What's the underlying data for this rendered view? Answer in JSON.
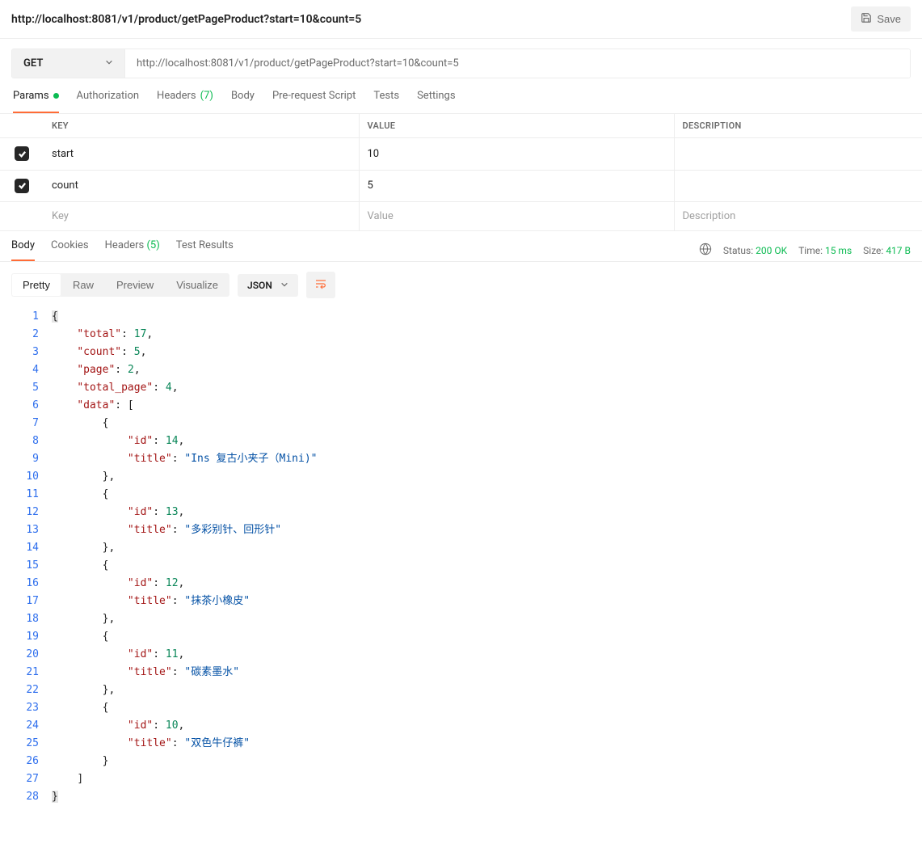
{
  "header": {
    "title": "http://localhost:8081/v1/product/getPageProduct?start=10&count=5",
    "save_label": "Save"
  },
  "request": {
    "method": "GET",
    "url": "http://localhost:8081/v1/product/getPageProduct?start=10&count=5"
  },
  "req_tabs": {
    "params": "Params",
    "authorization": "Authorization",
    "headers": "Headers",
    "headers_count": "(7)",
    "body": "Body",
    "prerequest": "Pre-request Script",
    "tests": "Tests",
    "settings": "Settings"
  },
  "params_table": {
    "col_key": "KEY",
    "col_value": "VALUE",
    "col_desc": "DESCRIPTION",
    "rows": [
      {
        "key": "start",
        "value": "10",
        "desc": ""
      },
      {
        "key": "count",
        "value": "5",
        "desc": ""
      }
    ],
    "ph_key": "Key",
    "ph_value": "Value",
    "ph_desc": "Description"
  },
  "resp_tabs": {
    "body": "Body",
    "cookies": "Cookies",
    "headers": "Headers",
    "headers_count": "(5)",
    "test_results": "Test Results"
  },
  "resp_meta": {
    "status_label": "Status:",
    "status_value": "200 OK",
    "time_label": "Time:",
    "time_value": "15 ms",
    "size_label": "Size:",
    "size_value": "417 B"
  },
  "view": {
    "pretty": "Pretty",
    "raw": "Raw",
    "preview": "Preview",
    "visualize": "Visualize",
    "format": "JSON"
  },
  "response_json": {
    "total": 17,
    "count": 5,
    "page": 2,
    "total_page": 4,
    "data": [
      {
        "id": 14,
        "title": "Ins 复古小夹子（Mini)"
      },
      {
        "id": 13,
        "title": "多彩别针、回形针"
      },
      {
        "id": 12,
        "title": "抹茶小橡皮"
      },
      {
        "id": 11,
        "title": "碳素墨水"
      },
      {
        "id": 10,
        "title": "双色牛仔裤"
      }
    ]
  },
  "code_lines": [
    {
      "n": 1,
      "indent": 0,
      "tokens": [
        {
          "cls": "hl pun",
          "t": "{"
        }
      ]
    },
    {
      "n": 2,
      "indent": 1,
      "tokens": [
        {
          "cls": "key",
          "t": "\"total\""
        },
        {
          "cls": "pun",
          "t": ": "
        },
        {
          "cls": "num",
          "t": "17"
        },
        {
          "cls": "pun",
          "t": ","
        }
      ]
    },
    {
      "n": 3,
      "indent": 1,
      "tokens": [
        {
          "cls": "key",
          "t": "\"count\""
        },
        {
          "cls": "pun",
          "t": ": "
        },
        {
          "cls": "num",
          "t": "5"
        },
        {
          "cls": "pun",
          "t": ","
        }
      ]
    },
    {
      "n": 4,
      "indent": 1,
      "tokens": [
        {
          "cls": "key",
          "t": "\"page\""
        },
        {
          "cls": "pun",
          "t": ": "
        },
        {
          "cls": "num",
          "t": "2"
        },
        {
          "cls": "pun",
          "t": ","
        }
      ]
    },
    {
      "n": 5,
      "indent": 1,
      "tokens": [
        {
          "cls": "key",
          "t": "\"total_page\""
        },
        {
          "cls": "pun",
          "t": ": "
        },
        {
          "cls": "num",
          "t": "4"
        },
        {
          "cls": "pun",
          "t": ","
        }
      ]
    },
    {
      "n": 6,
      "indent": 1,
      "tokens": [
        {
          "cls": "key",
          "t": "\"data\""
        },
        {
          "cls": "pun",
          "t": ": ["
        }
      ]
    },
    {
      "n": 7,
      "indent": 2,
      "tokens": [
        {
          "cls": "pun",
          "t": "{"
        }
      ]
    },
    {
      "n": 8,
      "indent": 3,
      "tokens": [
        {
          "cls": "key",
          "t": "\"id\""
        },
        {
          "cls": "pun",
          "t": ": "
        },
        {
          "cls": "num",
          "t": "14"
        },
        {
          "cls": "pun",
          "t": ","
        }
      ]
    },
    {
      "n": 9,
      "indent": 3,
      "tokens": [
        {
          "cls": "key",
          "t": "\"title\""
        },
        {
          "cls": "pun",
          "t": ": "
        },
        {
          "cls": "str",
          "t": "\"Ins 复古小夹子（Mini)\""
        }
      ]
    },
    {
      "n": 10,
      "indent": 2,
      "tokens": [
        {
          "cls": "pun",
          "t": "},"
        }
      ]
    },
    {
      "n": 11,
      "indent": 2,
      "tokens": [
        {
          "cls": "pun",
          "t": "{"
        }
      ]
    },
    {
      "n": 12,
      "indent": 3,
      "tokens": [
        {
          "cls": "key",
          "t": "\"id\""
        },
        {
          "cls": "pun",
          "t": ": "
        },
        {
          "cls": "num",
          "t": "13"
        },
        {
          "cls": "pun",
          "t": ","
        }
      ]
    },
    {
      "n": 13,
      "indent": 3,
      "tokens": [
        {
          "cls": "key",
          "t": "\"title\""
        },
        {
          "cls": "pun",
          "t": ": "
        },
        {
          "cls": "str",
          "t": "\"多彩别针、回形针\""
        }
      ]
    },
    {
      "n": 14,
      "indent": 2,
      "tokens": [
        {
          "cls": "pun",
          "t": "},"
        }
      ]
    },
    {
      "n": 15,
      "indent": 2,
      "tokens": [
        {
          "cls": "pun",
          "t": "{"
        }
      ]
    },
    {
      "n": 16,
      "indent": 3,
      "tokens": [
        {
          "cls": "key",
          "t": "\"id\""
        },
        {
          "cls": "pun",
          "t": ": "
        },
        {
          "cls": "num",
          "t": "12"
        },
        {
          "cls": "pun",
          "t": ","
        }
      ]
    },
    {
      "n": 17,
      "indent": 3,
      "tokens": [
        {
          "cls": "key",
          "t": "\"title\""
        },
        {
          "cls": "pun",
          "t": ": "
        },
        {
          "cls": "str",
          "t": "\"抹茶小橡皮\""
        }
      ]
    },
    {
      "n": 18,
      "indent": 2,
      "tokens": [
        {
          "cls": "pun",
          "t": "},"
        }
      ]
    },
    {
      "n": 19,
      "indent": 2,
      "tokens": [
        {
          "cls": "pun",
          "t": "{"
        }
      ]
    },
    {
      "n": 20,
      "indent": 3,
      "tokens": [
        {
          "cls": "key",
          "t": "\"id\""
        },
        {
          "cls": "pun",
          "t": ": "
        },
        {
          "cls": "num",
          "t": "11"
        },
        {
          "cls": "pun",
          "t": ","
        }
      ]
    },
    {
      "n": 21,
      "indent": 3,
      "tokens": [
        {
          "cls": "key",
          "t": "\"title\""
        },
        {
          "cls": "pun",
          "t": ": "
        },
        {
          "cls": "str",
          "t": "\"碳素墨水\""
        }
      ]
    },
    {
      "n": 22,
      "indent": 2,
      "tokens": [
        {
          "cls": "pun",
          "t": "},"
        }
      ]
    },
    {
      "n": 23,
      "indent": 2,
      "tokens": [
        {
          "cls": "pun",
          "t": "{"
        }
      ]
    },
    {
      "n": 24,
      "indent": 3,
      "tokens": [
        {
          "cls": "key",
          "t": "\"id\""
        },
        {
          "cls": "pun",
          "t": ": "
        },
        {
          "cls": "num",
          "t": "10"
        },
        {
          "cls": "pun",
          "t": ","
        }
      ]
    },
    {
      "n": 25,
      "indent": 3,
      "tokens": [
        {
          "cls": "key",
          "t": "\"title\""
        },
        {
          "cls": "pun",
          "t": ": "
        },
        {
          "cls": "str",
          "t": "\"双色牛仔裤\""
        }
      ]
    },
    {
      "n": 26,
      "indent": 2,
      "tokens": [
        {
          "cls": "pun",
          "t": "}"
        }
      ]
    },
    {
      "n": 27,
      "indent": 1,
      "tokens": [
        {
          "cls": "pun",
          "t": "]"
        }
      ]
    },
    {
      "n": 28,
      "indent": 0,
      "tokens": [
        {
          "cls": "hl pun",
          "t": "}"
        }
      ]
    }
  ]
}
